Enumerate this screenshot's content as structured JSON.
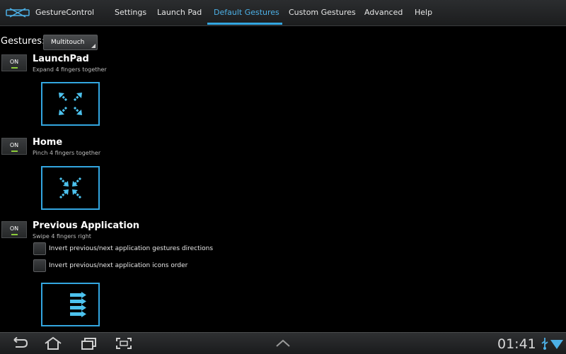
{
  "app": {
    "title": "GestureControl"
  },
  "tabs": [
    {
      "label": "Settings",
      "active": false
    },
    {
      "label": "Launch Pad",
      "active": false
    },
    {
      "label": "Default Gestures",
      "active": true
    },
    {
      "label": "Custom Gestures",
      "active": false
    },
    {
      "label": "Advanced",
      "active": false
    },
    {
      "label": "Help",
      "active": false
    }
  ],
  "gestures_selector": {
    "label": "Gestures:",
    "value": "Multitouch"
  },
  "items": [
    {
      "title": "LaunchPad",
      "subtitle": "Expand 4 fingers together",
      "toggle": "ON",
      "preview_icon": "expand-arrows-icon"
    },
    {
      "title": "Home",
      "subtitle": "Pinch 4 fingers together",
      "toggle": "ON",
      "preview_icon": "pinch-arrows-icon"
    },
    {
      "title": "Previous Application",
      "subtitle": "Swipe 4 fingers right",
      "toggle": "ON",
      "preview_icon": "swipe-right-arrows-icon"
    }
  ],
  "options": [
    {
      "label": "Invert previous/next application gestures directions",
      "checked": false
    },
    {
      "label": "Invert previous/next application icons order",
      "checked": false
    }
  ],
  "system_bar": {
    "time": "01:41",
    "icons": [
      "back-icon",
      "home-icon",
      "recent-apps-icon",
      "screenshot-icon",
      "up-chevron-icon",
      "usb-icon",
      "wifi-icon"
    ]
  },
  "colors": {
    "accent": "#33a6e0",
    "toggle_on": "#8ccc3a",
    "background": "#000000"
  }
}
